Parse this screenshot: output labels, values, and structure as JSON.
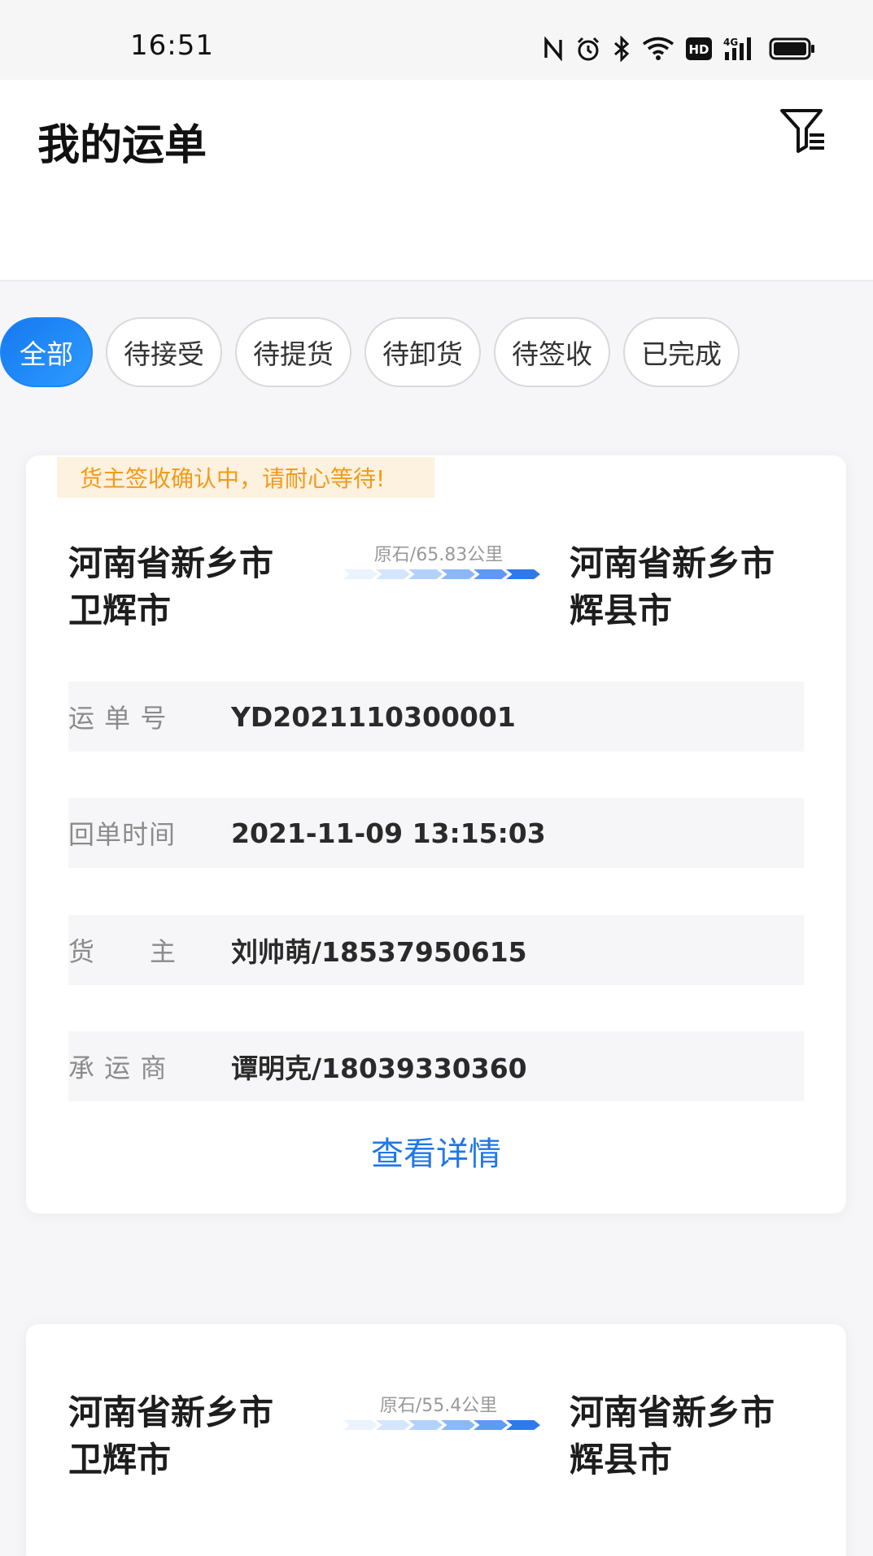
{
  "status_bar": {
    "time": "16:51",
    "icons": [
      "nfc-icon",
      "alarm-icon",
      "bluetooth-icon",
      "wifi-icon",
      "hd-icon",
      "signal-4g-icon",
      "battery-icon"
    ],
    "network_label": "4G",
    "hd_label": "HD"
  },
  "header": {
    "title": "我的运单",
    "filter_icon": "filter-icon"
  },
  "tabs": [
    {
      "label": "全部",
      "active": true
    },
    {
      "label": "待接受",
      "active": false
    },
    {
      "label": "待提货",
      "active": false
    },
    {
      "label": "待卸货",
      "active": false
    },
    {
      "label": "待签收",
      "active": false
    },
    {
      "label": "已完成",
      "active": false
    }
  ],
  "orders": [
    {
      "notice": "货主签收确认中，请耐心等待!",
      "origin": "河南省新乡市\n卫辉市",
      "destination": "河南省新乡市\n辉县市",
      "distance": "原石/65.83公里",
      "fields": [
        {
          "label": "运 单 号",
          "value": "YD2021110300001"
        },
        {
          "label": "回单时间",
          "value": "2021-11-09 13:15:03"
        },
        {
          "label": "货      主",
          "value": "刘帅萌/18537950615"
        },
        {
          "label": "承 运 商",
          "value": "谭明克/18039330360"
        }
      ],
      "detail_label": "查看详情"
    },
    {
      "origin": "河南省新乡市\n卫辉市",
      "destination": "河南省新乡市\n辉县市",
      "distance": "原石/55.4公里"
    }
  ],
  "colors": {
    "accent": "#1f78e8",
    "tab_active": "#1d84f5",
    "notice_bg": "#fdf1df",
    "notice_text": "#f39a18"
  }
}
